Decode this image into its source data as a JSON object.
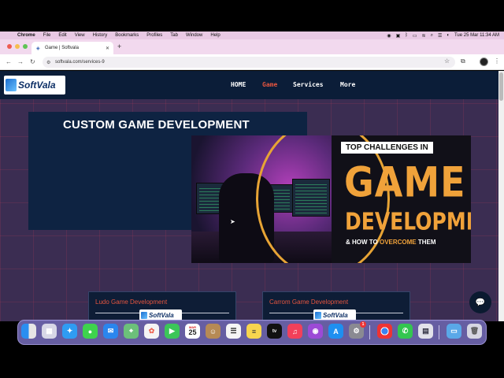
{
  "menubar": {
    "app": "Chrome",
    "items": [
      "File",
      "Edit",
      "View",
      "History",
      "Bookmarks",
      "Profiles",
      "Tab",
      "Window",
      "Help"
    ],
    "datetime": "Tue 25 Mar  11:34 AM"
  },
  "browser": {
    "tab_title": "Game | Softvala",
    "new_tab": "+",
    "url": "softvala.com/services-9"
  },
  "site": {
    "logo_text": "SoftVala",
    "nav": [
      "HOME",
      "Game",
      "Services",
      "More"
    ],
    "active_nav": "Game",
    "hero_title": "CUSTOM GAME DEVELOPMENT",
    "banner": {
      "top_line_prefix": "TOP ",
      "top_line_emph": "CHALLENGES",
      "top_line_suffix": " IN",
      "big_line_1": "GAME",
      "big_line_2": "DEVELOPMENT",
      "sub_prefix": "& HOW TO ",
      "sub_emph": "OVERCOME",
      "sub_suffix": " THEM"
    },
    "cards": [
      {
        "title": "Ludo Game Development",
        "logo": "SoftVala"
      },
      {
        "title": "Carrom Game Development",
        "logo": "SoftVala"
      }
    ]
  },
  "dock": {
    "apps": [
      "finder-icon",
      "launchpad-icon",
      "safari-icon",
      "messages-icon",
      "mail-icon",
      "maps-icon",
      "photos-icon",
      "facetime-icon",
      "calendar-icon",
      "contacts-icon",
      "reminders-icon",
      "notes-icon",
      "tv-icon",
      "music-icon",
      "podcasts-icon",
      "appstore-icon",
      "settings-icon",
      "chrome-icon",
      "whatsapp-icon",
      "preview-icon",
      "folder-icon",
      "trash-icon"
    ],
    "calendar_month": "MAR",
    "calendar_day": "25",
    "tv_label": "tv",
    "settings_badge": "1"
  },
  "colors": {
    "page_bg": "#3b2d52",
    "header_bg": "#0b1d38",
    "accent": "#e5553f",
    "banner_orange": "#f0a23a",
    "menubar_bg": "#e9c9e4"
  }
}
